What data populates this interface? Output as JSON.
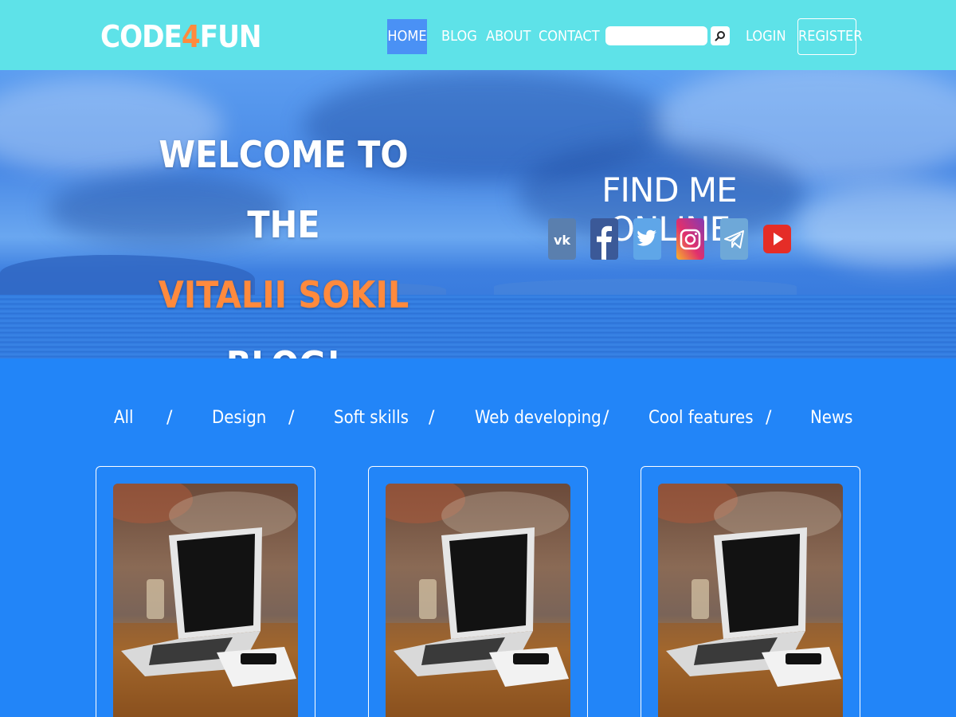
{
  "header": {
    "logo_prefix": "CODE",
    "logo_accent": "4",
    "logo_suffix": "FUN",
    "nav": {
      "home": "HOME",
      "blog": "BLOG",
      "about": "ABOUT",
      "contact": "CONTACT",
      "login": "LOGIN",
      "register": "REGISTER"
    },
    "search": {
      "value": "",
      "placeholder": ""
    }
  },
  "hero": {
    "welcome_line1": "WELCOME TO THE",
    "welcome_name": "VITALII SOKIL",
    "welcome_line3": "BLOG!",
    "find_title": "FIND ME ONLINE",
    "socials": [
      "vk-icon",
      "facebook-icon",
      "twitter-icon",
      "instagram-icon",
      "telegram-icon",
      "youtube-icon"
    ]
  },
  "filters": {
    "separator": "/",
    "items": [
      "All",
      "Design",
      "Soft skills",
      "Web developing",
      "Cool features",
      "News"
    ]
  },
  "colors": {
    "header_bg": "#5ee2e8",
    "accent_orange": "#ff8a3d",
    "main_bg": "#2285f8",
    "active_nav": "#4a91f5"
  }
}
